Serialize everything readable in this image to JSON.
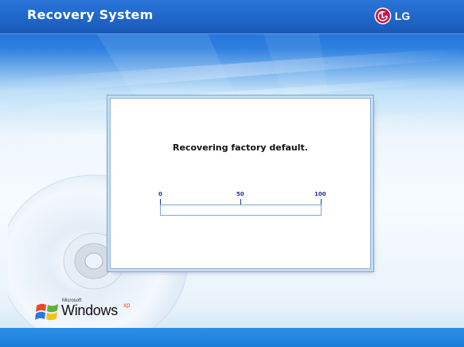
{
  "header": {
    "title": "Recovery System",
    "brand": "LG",
    "brand_icon": "lg-logo-icon"
  },
  "dialog": {
    "status_text": "Recovering factory default.",
    "progress": {
      "value": 0,
      "ticks": [
        "0",
        "50",
        "100"
      ]
    }
  },
  "footer": {
    "windows_small": "Microsoft",
    "windows_label": "Windows",
    "windows_suffix": "xp",
    "windows_icon": "windows-flag-icon"
  },
  "colors": {
    "header_blue": "#1d62c4",
    "tick_blue": "#22319a",
    "progress_border": "#7aa7d6"
  }
}
